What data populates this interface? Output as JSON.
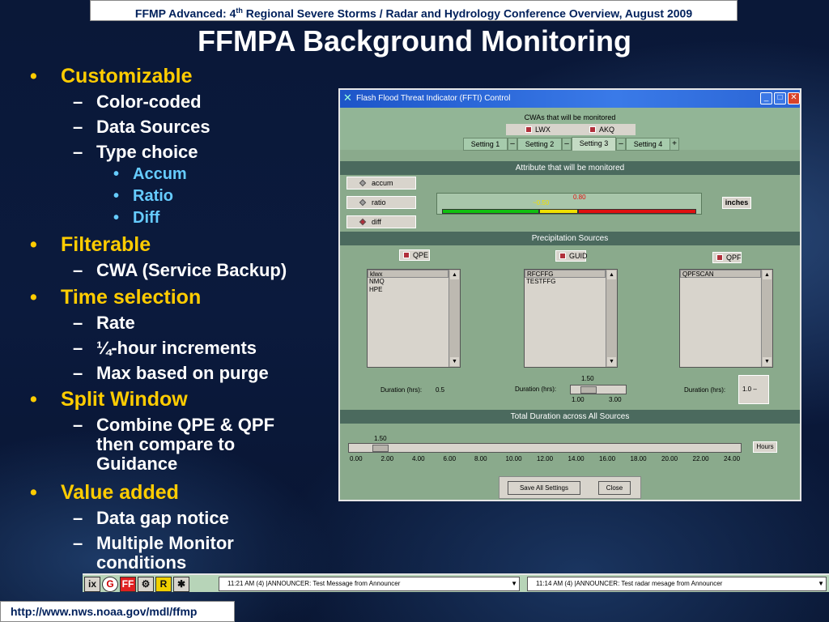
{
  "header": {
    "conference_pre": "FFMP Advanced: 4",
    "conference_sup": "th",
    "conference_post": " Regional Severe Storms / Radar and Hydrology Conference Overview, August 2009",
    "title": "FFMPA Background Monitoring"
  },
  "bullets": [
    {
      "level": 1,
      "text": "Customizable"
    },
    {
      "level": 2,
      "text": "Color-coded"
    },
    {
      "level": 2,
      "text": "Data Sources"
    },
    {
      "level": 2,
      "text": "Type choice"
    },
    {
      "level": 3,
      "text": "Accum"
    },
    {
      "level": 3,
      "text": "Ratio"
    },
    {
      "level": 3,
      "text": "Diff"
    },
    {
      "level": 1,
      "text": "Filterable"
    },
    {
      "level": 2,
      "text": "CWA (Service Backup)"
    },
    {
      "level": 1,
      "text": "Time selection"
    },
    {
      "level": 2,
      "text": "Rate"
    },
    {
      "level": 2,
      "text": "¼-hour increments"
    },
    {
      "level": 2,
      "text": "Max based on purge"
    },
    {
      "level": 1,
      "text": "Split Window"
    },
    {
      "level": 2,
      "lines": [
        "Combine QPE & QPF",
        "then compare to",
        "Guidance"
      ]
    },
    {
      "level": 1,
      "text": "Value added"
    },
    {
      "level": 2,
      "text": "Data gap notice"
    },
    {
      "level": 2,
      "lines": [
        "Multiple Monitor",
        "conditions"
      ]
    }
  ],
  "markers": {
    "l1": "•",
    "l2": "–",
    "l3": "•"
  },
  "window": {
    "title": "Flash Flood Threat Indicator (FFTI) Control",
    "cwa_header": "CWAs that will be monitored",
    "cwas": [
      "LWX",
      "AKQ"
    ],
    "tabs": [
      "Setting 1",
      "Setting 2",
      "Setting 3",
      "Setting 4"
    ],
    "tab_minus": "–",
    "tab_plus": "+",
    "active_tab": "Setting 3",
    "attribute_header": "Attribute that will be monitored",
    "attributes": [
      {
        "label": "accum",
        "selected": false
      },
      {
        "label": "ratio",
        "selected": false
      },
      {
        "label": "diff",
        "selected": true
      }
    ],
    "gauge": {
      "yellow_label": "~0.50",
      "red_label": "0.80",
      "yellow_color": "#f0e000",
      "red_color": "#e01010",
      "green_color": "#10c010"
    },
    "units": "inches",
    "precip_header": "Precipitation Sources",
    "sources": [
      {
        "label": "QPE",
        "items": [
          "klwx",
          "NMQ",
          "HPE"
        ],
        "duration_label": "Duration (hrs):",
        "duration_value": "0.5"
      },
      {
        "label": "GUID",
        "items": [
          "RFCFFG",
          "TESTFFG"
        ],
        "duration_label": "Duration (hrs):",
        "slider_value": "1.50",
        "slider_min": "1.00",
        "slider_max": "3.00"
      },
      {
        "label": "QPF",
        "items": [
          "QPFSCAN"
        ],
        "duration_label": "Duration (hrs):",
        "duration_value": "1.0",
        "duration_suffix": "–"
      }
    ],
    "total_header": "Total Duration across All Sources",
    "total": {
      "value": "1.50",
      "unit_button": "Hours",
      "ticks": [
        "0.00",
        "2.00",
        "4.00",
        "6.00",
        "8.00",
        "10.00",
        "12.00",
        "14.00",
        "16.00",
        "18.00",
        "20.00",
        "22.00",
        "24.00"
      ]
    },
    "buttons": {
      "save": "Save All Settings",
      "close": "Close"
    },
    "controls": {
      "min": "_",
      "max": "□",
      "close": "✕"
    }
  },
  "taskbar": {
    "icons": [
      "ix",
      "G",
      "FF",
      "⚙",
      "R",
      "✱"
    ],
    "message1": "11:21 AM (4) |ANNOUNCER: Test Message from Announcer",
    "message2": "11:14 AM (4) |ANNOUNCER: Test radar mesage from Announcer"
  },
  "footer_url": "http://www.nws.noaa.gov/mdl/ffmp"
}
